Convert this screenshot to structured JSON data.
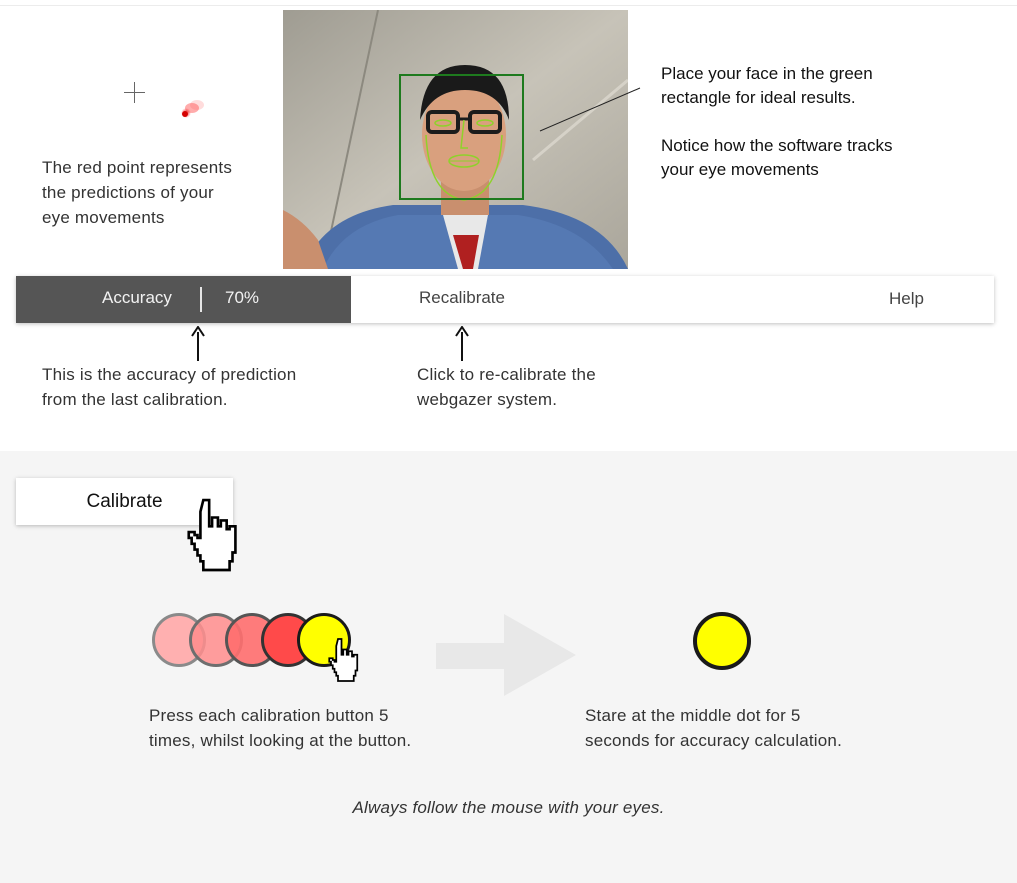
{
  "explanations": {
    "red_point": "The red point represents\nthe predictions of your\neye movements",
    "face_box": "Place your face in the green\nrectangle for ideal results.",
    "tracking": "Notice how the software tracks\nyour eye movements",
    "accuracy": "This is the accuracy of prediction\nfrom the last calibration.",
    "recalibrate": "Click to re-calibrate the\nwebgazer system."
  },
  "toolbar": {
    "accuracy_label": "Accuracy",
    "accuracy_value": "70%",
    "recalibrate_label": "Recalibrate",
    "help_label": "Help"
  },
  "calibration": {
    "button_label": "Calibrate",
    "step1": "Press each calibration button 5\ntimes, whilst looking at the button.",
    "step2": "Stare at the middle dot for 5\nseconds for accuracy calculation.",
    "footer_note": "Always follow the mouse with your eyes."
  },
  "colors": {
    "toolbar_dark": "#555555",
    "panel_bg": "#f5f5f5",
    "face_box": "#1e7a1e",
    "dot_yellow": "#ffff00",
    "dot_red": "#ff4a4a"
  },
  "icons": [
    "crosshair-icon",
    "hand-pointer-icon",
    "arrow-up-icon",
    "arrow-right-icon"
  ]
}
